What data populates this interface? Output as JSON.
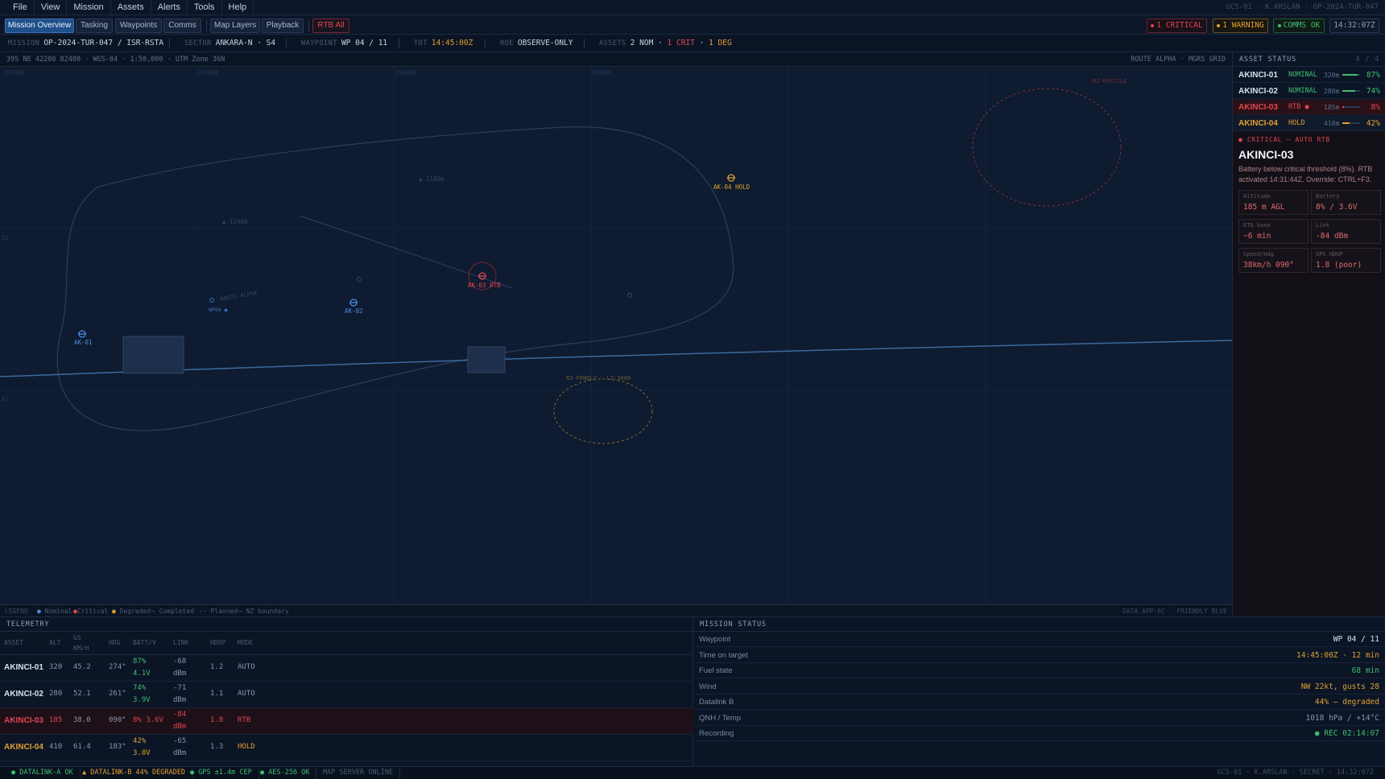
{
  "menubar": {
    "items": [
      "File",
      "View",
      "Mission",
      "Assets",
      "Alerts",
      "Tools",
      "Help"
    ],
    "right_info": "GCS-01 · K.ARSLAN · OP-2024-TUR-047"
  },
  "toolbar": {
    "tabs": [
      "Mission Overview",
      "Tasking",
      "Waypoints",
      "Comms"
    ],
    "map_layers": "Map Layers",
    "playback": "Playback",
    "rtb_all": "RTB All",
    "critical_pill": "1 CRITICAL",
    "warning_pill": "1 WARNING",
    "comms_pill": "COMMS OK",
    "clock": "14:32:07Z",
    "colors": {
      "critical": "#e0454f",
      "warning": "#e0a030",
      "ok": "#3fbf6f"
    }
  },
  "infobar": {
    "mission_label": "MISSION",
    "mission_value": "OP-2024-TUR-047 / ISR-RSTA",
    "sector_label": "SECTOR",
    "sector_value": "ANKARA-N · S4",
    "waypoint_label": "WAYPOINT",
    "waypoint_value": "WP 04 / 11",
    "tot_label": "TOT",
    "tot_value": "14:45:00Z",
    "roe_label": "ROE",
    "roe_value": "OBSERVE-ONLY",
    "assets_label": "ASSETS",
    "assets_nom": "2 NOM",
    "assets_dot1": "·",
    "assets_crit": "1 CRIT",
    "assets_dot2": "·",
    "assets_deg": "1 DEG"
  },
  "map": {
    "coord_left": "39S NE 42200 82400 · WGS-84 · 1:50,000 · UTM Zone 36N",
    "coord_right": "ROUTE ALPHA · MGRS GRID",
    "grid_labels": [
      "39200E",
      "39400E",
      "39600E",
      "39800E"
    ],
    "grid_row_labels": [
      "82",
      "81"
    ],
    "markers": {
      "ak01": "AK-01",
      "ak02": "AK-02",
      "ak03": "AK-03 RTB",
      "ak04": "AK-04 HOLD"
    },
    "alt_labels": [
      "▲ 1180m",
      "▲ 1240m"
    ],
    "route_label": "ROUTE ALPHA",
    "wp04_label": "WP04 ●",
    "nfz_label": "R2-HOSTILE",
    "lz_label": "R2-FRNDLY · LZ-3000",
    "legend": {
      "title": "LEGEND",
      "nominal": "Nominal",
      "critical": "Critical",
      "degraded": "Degraded",
      "completed": "Completed",
      "planned": "Planned",
      "nfz": "NZ boundary",
      "right": "DATA APP-6C · FRIENDLY BLUE"
    }
  },
  "asset_status": {
    "title": "ASSET STATUS",
    "count": "4 / 4",
    "rows": [
      {
        "name": "AKINCI-01",
        "mode": "NOMINAL",
        "alt": "320m",
        "batt": 0.87,
        "pct": "87%",
        "color": "#3fbf6f",
        "name_color": "#d6e0ee"
      },
      {
        "name": "AKINCI-02",
        "mode": "NOMINAL",
        "alt": "280m",
        "batt": 0.74,
        "pct": "74%",
        "color": "#3fbf6f",
        "name_color": "#d6e0ee"
      },
      {
        "name": "AKINCI-03",
        "mode": "RTB ●",
        "alt": "185m",
        "batt": 0.08,
        "pct": "8%",
        "color": "#e0454f",
        "name_color": "#e0454f"
      },
      {
        "name": "AKINCI-04",
        "mode": "HOLD",
        "alt": "410m",
        "batt": 0.42,
        "pct": "42%",
        "color": "#e0a030",
        "name_color": "#e0a030"
      }
    ],
    "critical": {
      "header": "CRITICAL — AUTO RTB",
      "asset": "AKINCI-03",
      "message": "Battery below critical threshold (8%). RTB activated 14:31:44Z. Override: CTRL+F3.",
      "tiles": [
        {
          "k": "Altitude",
          "v": "185 m AGL"
        },
        {
          "k": "Battery",
          "v": "8% / 3.6V"
        },
        {
          "k": "ETA base",
          "v": "~6 min"
        },
        {
          "k": "Link",
          "v": "-84 dBm"
        },
        {
          "k": "Speed/Hdg",
          "v": "38km/h 090°"
        },
        {
          "k": "GPS HDOP",
          "v": "1.8 (poor)"
        }
      ]
    }
  },
  "telemetry": {
    "title": "TELEMETRY",
    "headers": [
      "ASSET",
      "ALT",
      "GS\nKM/H",
      "HDG",
      "BATT/V",
      "LINK",
      "HDOP",
      "MODE"
    ],
    "rows": [
      {
        "asset": "AKINCI-01",
        "alt": "320",
        "gs": "45.2",
        "hdg": "274°",
        "batt": "87%",
        "volt": "4.1V",
        "link": "-68",
        "dbm": "dBm",
        "hdop": "1.2",
        "mode": "AUTO",
        "state": "nom"
      },
      {
        "asset": "AKINCI-02",
        "alt": "280",
        "gs": "52.1",
        "hdg": "261°",
        "batt": "74%",
        "volt": "3.9V",
        "link": "-71",
        "dbm": "dBm",
        "hdop": "1.1",
        "mode": "AUTO",
        "state": "nom"
      },
      {
        "asset": "AKINCI-03",
        "alt": "185",
        "gs": "38.0",
        "hdg": "090°",
        "batt": "8% 3.6V",
        "volt": "",
        "link": "-84",
        "dbm": "dBm",
        "hdop": "1.8",
        "mode": "RTB",
        "state": "crit"
      },
      {
        "asset": "AKINCI-04",
        "alt": "410",
        "gs": "61.4",
        "hdg": "183°",
        "batt": "42%",
        "volt": "3.8V",
        "link": "-65",
        "dbm": "dBm",
        "hdop": "1.3",
        "mode": "HOLD",
        "state": "deg"
      }
    ]
  },
  "mission_status": {
    "title": "MISSION STATUS",
    "rows": [
      {
        "k": "Waypoint",
        "v": "WP 04 / 11",
        "color": "#d6e0ee"
      },
      {
        "k": "Time on target",
        "v": "14:45:00Z · 12 min",
        "color": "#e0a030"
      },
      {
        "k": "Fuel state",
        "v": "68 min",
        "color": "#3fbf6f"
      },
      {
        "k": "Wind",
        "v": "NW 22kt, gusts 28",
        "color": "#e0a030"
      },
      {
        "k": "Datalink B",
        "v": "44% — degraded",
        "color": "#e0a030"
      },
      {
        "k": "QNH / Temp",
        "v": "1018 hPa / +14°C",
        "color": "#8696ad"
      },
      {
        "k": "Recording",
        "v": "● REC 02:14:07",
        "color": "#3fbf6f"
      }
    ]
  },
  "statusbar": {
    "items": [
      {
        "t": "● DATALINK-A OK",
        "c": "#3fbf6f"
      },
      {
        "t": "▲ DATALINK-B 44% DEGRADED",
        "c": "#e0a030"
      },
      {
        "t": "● GPS ±1.4m CEP",
        "c": "#3fbf6f"
      },
      {
        "t": "● AES-256 OK",
        "c": "#3fbf6f"
      },
      {
        "t": "MAP SERVER ONLINE",
        "c": "#4b5c76"
      }
    ],
    "right": "GCS-01 · K.ARSLAN · SECRET · 14:32:07Z"
  }
}
